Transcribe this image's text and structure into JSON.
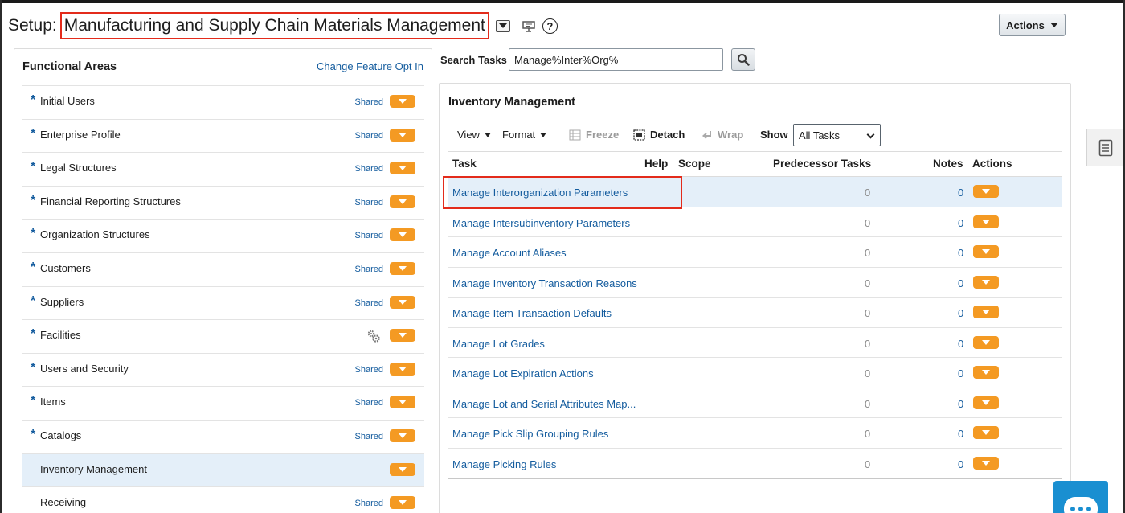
{
  "header": {
    "setup_label": "Setup:",
    "title": "Manufacturing and Supply Chain Materials Management",
    "actions_label": "Actions"
  },
  "functional_areas": {
    "title": "Functional Areas",
    "change_link": "Change Feature Opt In",
    "items": [
      {
        "label": "Initial Users",
        "required": true,
        "status": "Shared"
      },
      {
        "label": "Enterprise Profile",
        "required": true,
        "status": "Shared"
      },
      {
        "label": "Legal Structures",
        "required": true,
        "status": "Shared"
      },
      {
        "label": "Financial Reporting Structures",
        "required": true,
        "status": "Shared"
      },
      {
        "label": "Organization Structures",
        "required": true,
        "status": "Shared"
      },
      {
        "label": "Customers",
        "required": true,
        "status": "Shared"
      },
      {
        "label": "Suppliers",
        "required": true,
        "status": "Shared"
      },
      {
        "label": "Facilities",
        "required": true,
        "status": ""
      },
      {
        "label": "Users and Security",
        "required": true,
        "status": "Shared"
      },
      {
        "label": "Items",
        "required": true,
        "status": "Shared"
      },
      {
        "label": "Catalogs",
        "required": true,
        "status": "Shared"
      },
      {
        "label": "Inventory Management",
        "required": false,
        "status": ""
      },
      {
        "label": "Receiving",
        "required": false,
        "status": "Shared"
      }
    ]
  },
  "search": {
    "label": "Search Tasks",
    "value": "Manage%Inter%Org%"
  },
  "inventory": {
    "title": "Inventory Management",
    "toolbar": {
      "view": "View",
      "format": "Format",
      "freeze": "Freeze",
      "detach": "Detach",
      "wrap": "Wrap",
      "show_label": "Show",
      "show_value": "All Tasks"
    },
    "columns": {
      "task": "Task",
      "help": "Help",
      "scope": "Scope",
      "predecessor": "Predecessor Tasks",
      "notes": "Notes",
      "actions": "Actions"
    },
    "rows": [
      {
        "task": "Manage Interorganization Parameters",
        "predecessor": "0",
        "notes": "0"
      },
      {
        "task": "Manage Intersubinventory Parameters",
        "predecessor": "0",
        "notes": "0"
      },
      {
        "task": "Manage Account Aliases",
        "predecessor": "0",
        "notes": "0"
      },
      {
        "task": "Manage Inventory Transaction Reasons",
        "predecessor": "0",
        "notes": "0"
      },
      {
        "task": "Manage Item Transaction Defaults",
        "predecessor": "0",
        "notes": "0"
      },
      {
        "task": "Manage Lot Grades",
        "predecessor": "0",
        "notes": "0"
      },
      {
        "task": "Manage Lot Expiration Actions",
        "predecessor": "0",
        "notes": "0"
      },
      {
        "task": "Manage Lot and Serial Attributes Map...",
        "predecessor": "0",
        "notes": "0"
      },
      {
        "task": "Manage Pick Slip Grouping Rules",
        "predecessor": "0",
        "notes": "0"
      },
      {
        "task": "Manage Picking Rules",
        "predecessor": "0",
        "notes": "0"
      }
    ]
  },
  "colors": {
    "accent_orange": "#f49a23",
    "link_blue": "#145c9e",
    "highlight_red": "#e32b1b",
    "selected_row": "#e4eff9",
    "chat_blue": "#1a8fd1"
  }
}
